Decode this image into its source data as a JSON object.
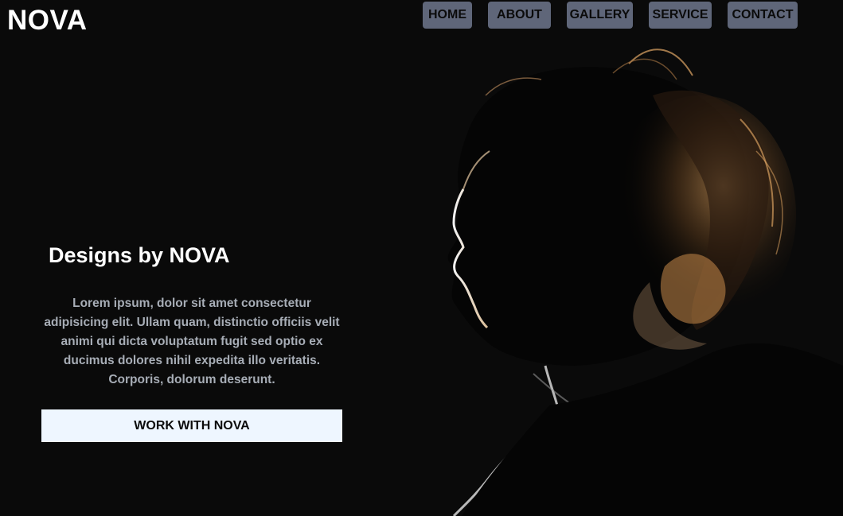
{
  "header": {
    "logo": "NOVA",
    "nav": [
      {
        "label": "HOME"
      },
      {
        "label": "ABOUT"
      },
      {
        "label": "GALLERY"
      },
      {
        "label": "SERVICE"
      },
      {
        "label": "CONTACT"
      }
    ]
  },
  "hero": {
    "title": "Designs by NOVA",
    "text": "Lorem ipsum, dolor sit amet consectetur adipisicing elit. Ullam quam, distinctio officiis velit animi qui dicta voluptatum fugit sed optio ex ducimus dolores nihil expedita illo veritatis. Corporis, dolorum deserunt.",
    "cta_label": "WORK WITH NOVA"
  },
  "colors": {
    "background": "#0a0a0a",
    "nav_button": "#5f6679",
    "cta_background": "#eef6ff",
    "rim_light": "#e0a060"
  },
  "image": {
    "subject": "silhouette-portrait-rim-lit"
  }
}
